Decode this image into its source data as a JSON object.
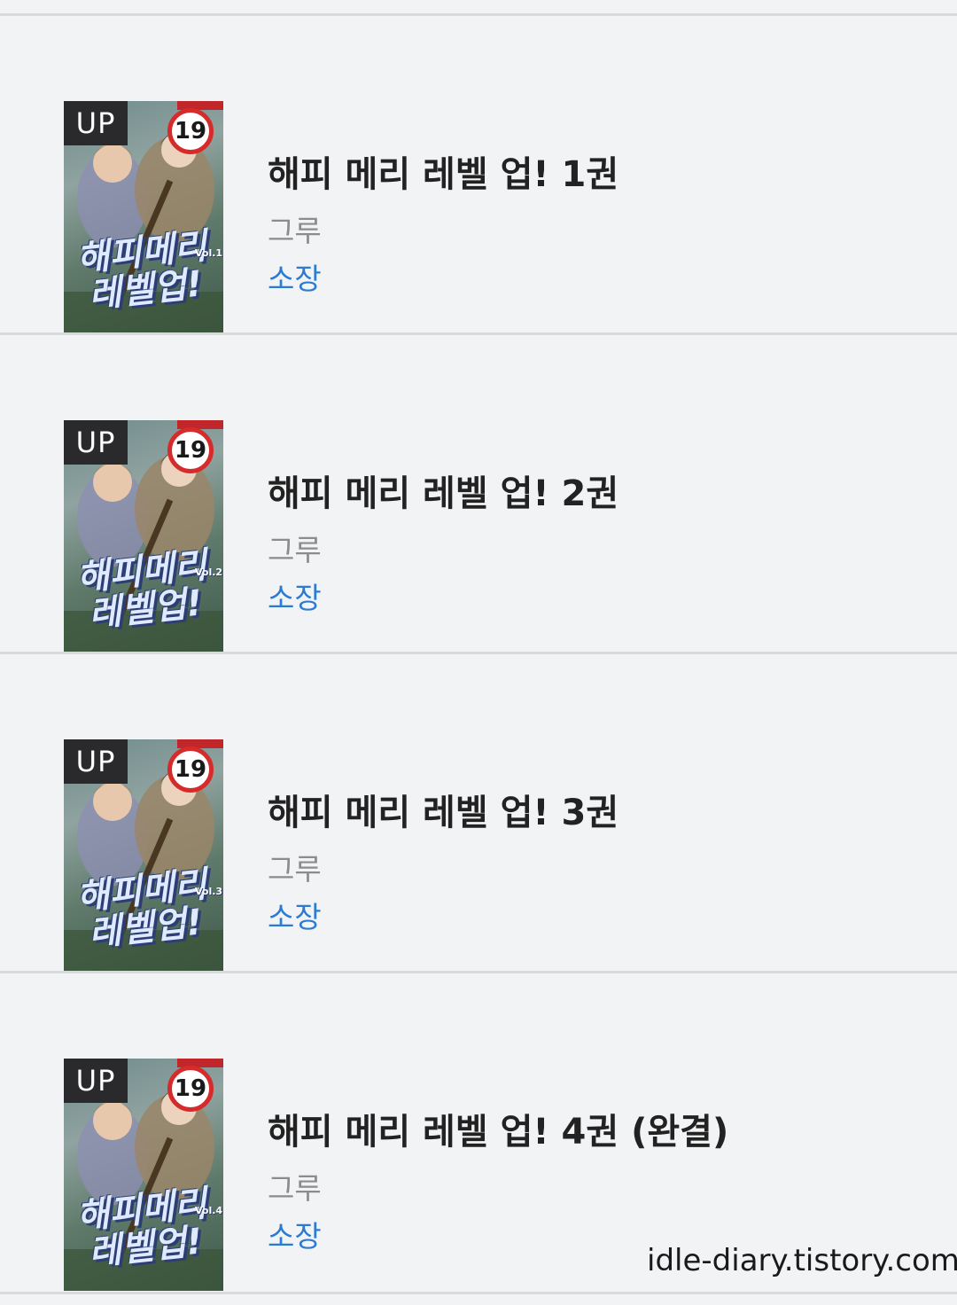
{
  "items": [
    {
      "badge": "UP",
      "age_rating": "19",
      "cover_title": "해피메리 레벨업!",
      "cover_volume": "Vol.1",
      "title": "해피 메리 레벨 업! 1권",
      "author": "그루",
      "status": "소장"
    },
    {
      "badge": "UP",
      "age_rating": "19",
      "cover_title": "해피메리 레벨업!",
      "cover_volume": "Vol.2",
      "title": "해피 메리 레벨 업! 2권",
      "author": "그루",
      "status": "소장"
    },
    {
      "badge": "UP",
      "age_rating": "19",
      "cover_title": "해피메리 레벨업!",
      "cover_volume": "Vol.3",
      "title": "해피 메리 레벨 업! 3권",
      "author": "그루",
      "status": "소장"
    },
    {
      "badge": "UP",
      "age_rating": "19",
      "cover_title": "해피메리 레벨업!",
      "cover_volume": "Vol.4",
      "title": "해피 메리 레벨 업! 4권 (완결)",
      "author": "그루",
      "status": "소장"
    }
  ],
  "watermark": "idle-diary.tistory.com",
  "colors": {
    "background": "#f2f3f5",
    "divider": "#d9dadd",
    "title": "#222222",
    "author": "#8c8c8c",
    "status": "#2b7bd4",
    "age_badge_border": "#d62b2b"
  }
}
